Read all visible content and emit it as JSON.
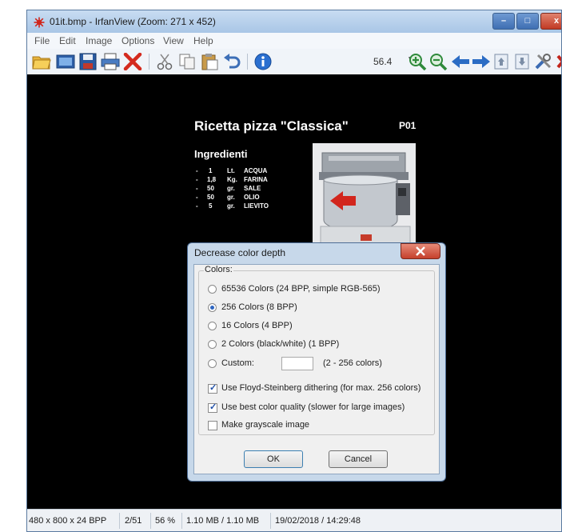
{
  "window": {
    "title": "01it.bmp - IrfanView (Zoom: 271 x 452)"
  },
  "title_buttons": {
    "minimize": "–",
    "maximize": "□",
    "close": "x"
  },
  "menu": [
    "File",
    "Edit",
    "Image",
    "Options",
    "View",
    "Help"
  ],
  "toolbar": {
    "zoom_value": "56.4",
    "icons": [
      "open-folder-icon",
      "slideshow-icon",
      "save-icon",
      "print-icon",
      "delete-icon",
      "cut-icon",
      "copy-icon",
      "paste-icon",
      "undo-icon",
      "info-icon",
      "zoom-in-icon",
      "zoom-out-icon",
      "previous-icon",
      "next-icon",
      "first-page-icon",
      "last-page-icon",
      "settings-icon",
      "exit-icon"
    ]
  },
  "image": {
    "title": "Ricetta pizza \"Classica\"",
    "code": "P01",
    "ingredients_header": "Ingredienti",
    "ingredients": [
      {
        "dash": "-",
        "qty": "1",
        "unit": "Lt.",
        "name": "ACQUA"
      },
      {
        "dash": "-",
        "qty": "1,8",
        "unit": "Kg.",
        "name": "FARINA"
      },
      {
        "dash": "-",
        "qty": "50",
        "unit": "gr.",
        "name": "SALE"
      },
      {
        "dash": "-",
        "qty": "50",
        "unit": "gr.",
        "name": "OLIO"
      },
      {
        "dash": "-",
        "qty": "5",
        "unit": "gr.",
        "name": "LIEVITO"
      }
    ]
  },
  "dialog": {
    "title": "Decrease color depth",
    "group_label": "Colors:",
    "radios": [
      {
        "label": "65536 Colors (24 BPP, simple RGB-565)",
        "selected": false
      },
      {
        "label": "256 Colors (8 BPP)",
        "selected": true
      },
      {
        "label": "16 Colors (4 BPP)",
        "selected": false
      },
      {
        "label": "2 Colors (black/white) (1 BPP)",
        "selected": false
      },
      {
        "label": "Custom:",
        "selected": false
      }
    ],
    "custom_value": "",
    "custom_hint": "(2 - 256 colors)",
    "checkboxes": [
      {
        "label": "Use Floyd-Steinberg dithering (for max. 256 colors)",
        "checked": true
      },
      {
        "label": "Use best color quality (slower for large images)",
        "checked": true
      },
      {
        "label": "Make grayscale image",
        "checked": false
      }
    ],
    "ok_label": "OK",
    "cancel_label": "Cancel"
  },
  "status": {
    "dimensions": "480 x 800 x 24 BPP",
    "page": "2/51",
    "zoom": "56 %",
    "size": "1.10 MB / 1.10 MB",
    "datetime": "19/02/2018 / 14:29:48"
  }
}
